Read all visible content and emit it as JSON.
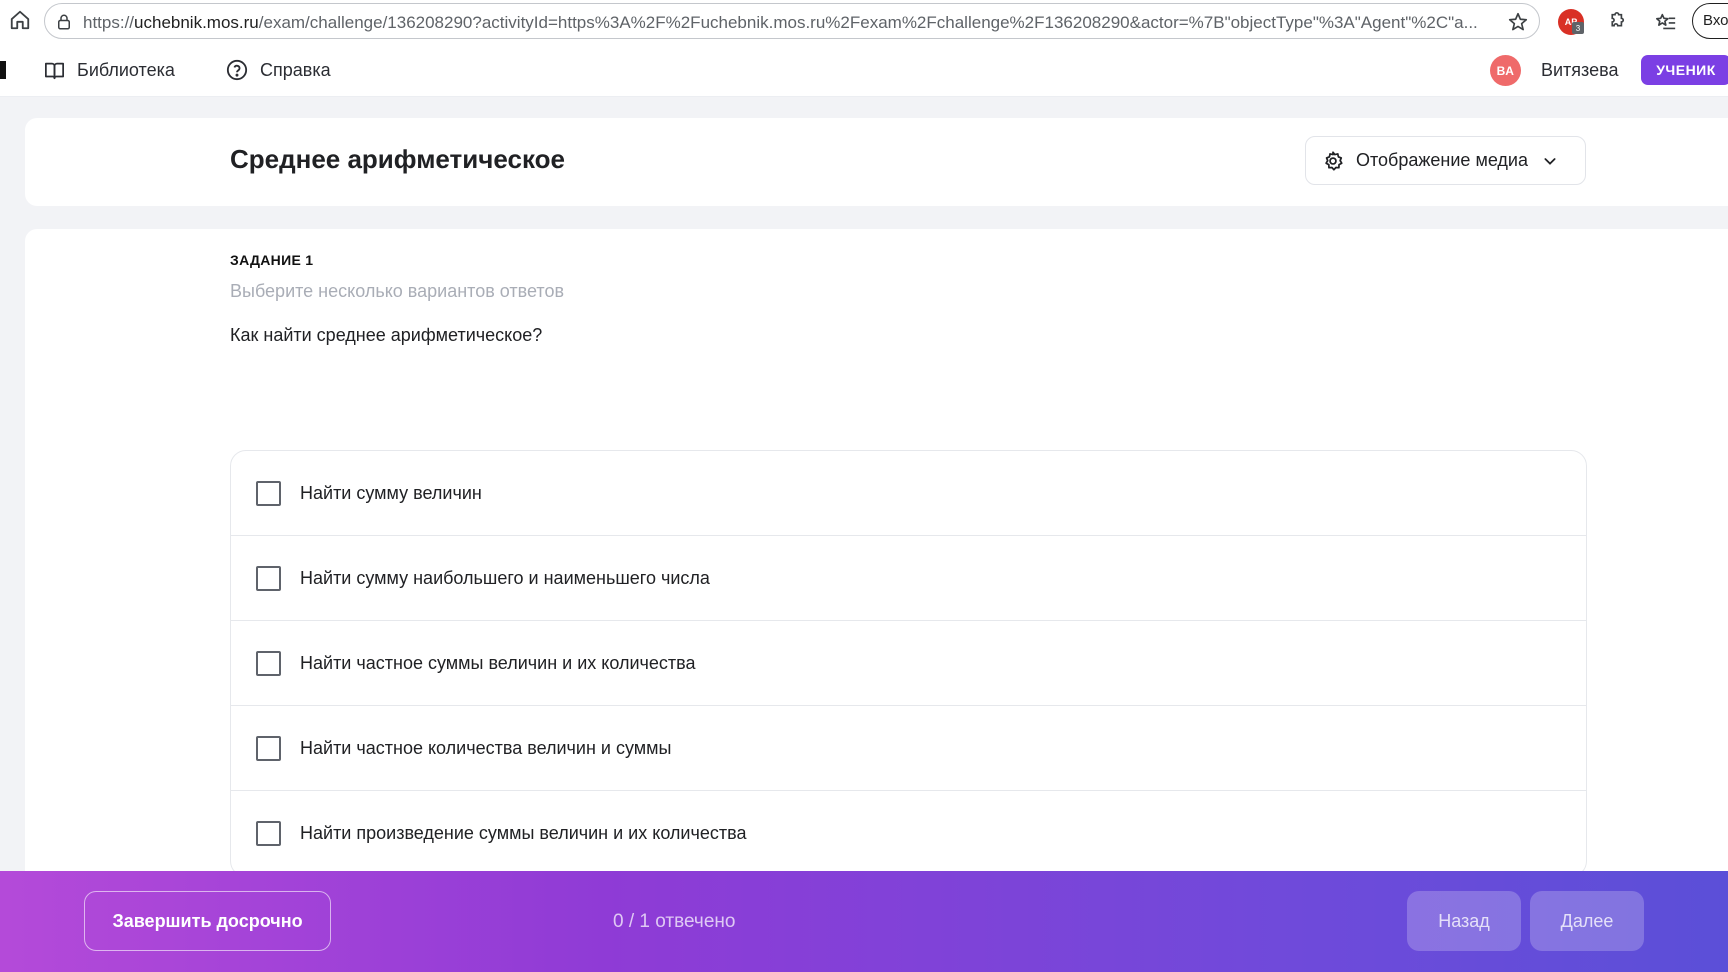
{
  "browser": {
    "url_prefix": "https://",
    "url_host": "uchebnik.mos.ru",
    "url_rest": "/exam/challenge/136208290?activityId=https%3A%2F%2Fuchebnik.mos.ru%2Fexam%2Fchallenge%2F136208290&actor=%7B\"objectType\"%3A\"Agent\"%2C\"a...",
    "extension_badge": "AP",
    "extension_count": "3",
    "signin_label": "Вхо"
  },
  "header": {
    "nav": [
      {
        "label": "Библиотека",
        "icon": "book-icon"
      },
      {
        "label": "Справка",
        "icon": "help-circle-icon"
      }
    ],
    "avatar_initials": "ВА",
    "user_name": "Витязева",
    "role_badge": "УЧЕНИК"
  },
  "page": {
    "title": "Среднее арифметическое",
    "media_button_label": "Отображение медиа"
  },
  "task": {
    "number_label": "ЗАДАНИЕ 1",
    "hint": "Выберите несколько вариантов ответов",
    "question": "Как найти среднее арифметическое?",
    "options": [
      {
        "label": "Найти сумму величин",
        "checked": false
      },
      {
        "label": "Найти сумму наибольшего и наименьшего числа",
        "checked": false
      },
      {
        "label": "Найти частное суммы величин и их количества",
        "checked": false
      },
      {
        "label": "Найти частное количества величин и суммы",
        "checked": false
      },
      {
        "label": "Найти произведение суммы величин и их количества",
        "checked": false
      }
    ]
  },
  "footer": {
    "finish_label": "Завершить досрочно",
    "progress_text": "0 / 1 отвечено",
    "back_label": "Назад",
    "next_label": "Далее"
  },
  "colors": {
    "accent": "#7b3fe4",
    "footer_gradient_start": "#b44ad9",
    "footer_gradient_end": "#5b4fd8",
    "avatar": "#ef6a6a"
  }
}
